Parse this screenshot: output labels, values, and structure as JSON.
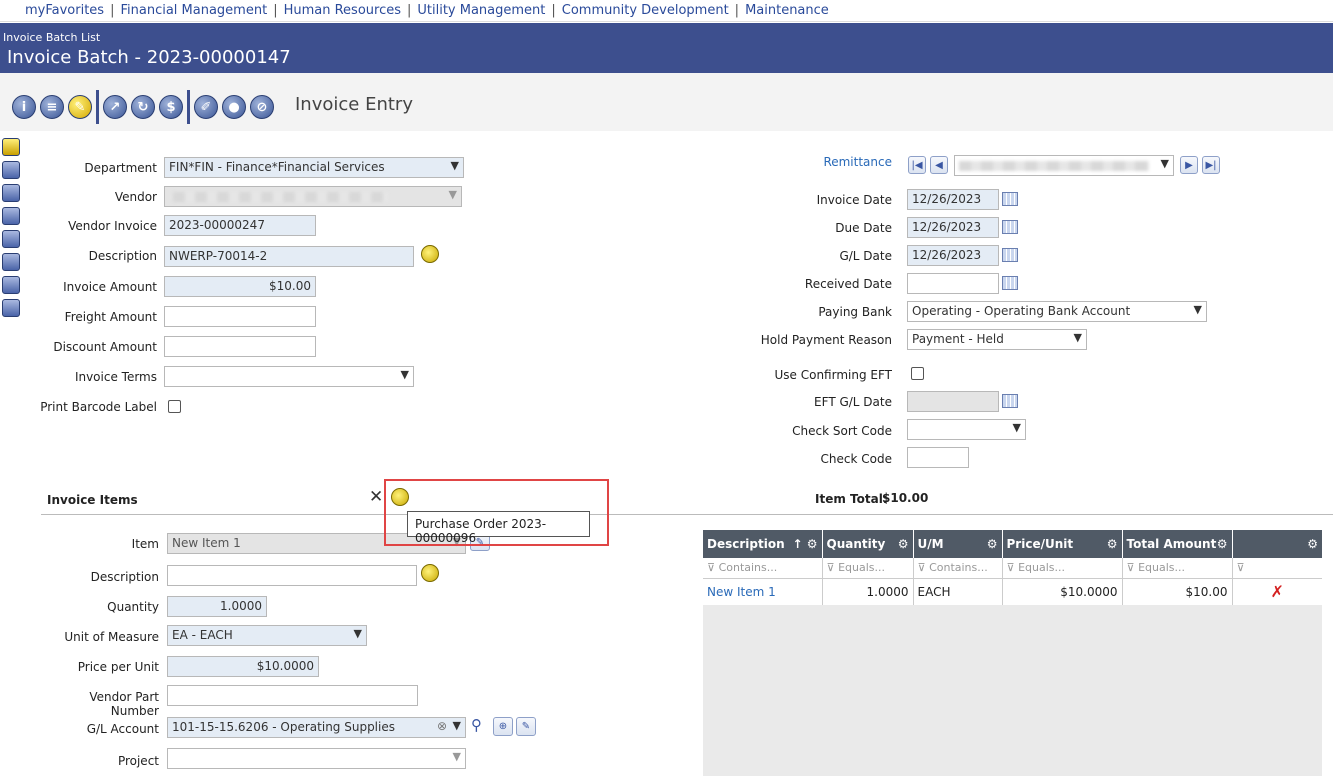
{
  "topnav": {
    "items": [
      "myFavorites",
      "Financial Management",
      "Human Resources",
      "Utility Management",
      "Community Development",
      "Maintenance"
    ]
  },
  "header": {
    "breadcrumb": "Invoice Batch List",
    "title": "Invoice Batch - 2023-00000147"
  },
  "toolbar": {
    "title": "Invoice Entry"
  },
  "form": {
    "department_label": "Department",
    "department_value": "FIN*FIN - Finance*Financial Services",
    "vendor_label": "Vendor",
    "vendor_invoice_label": "Vendor Invoice",
    "vendor_invoice_value": "2023-00000247",
    "description_label": "Description",
    "description_value": "NWERP-70014-2",
    "invoice_amount_label": "Invoice Amount",
    "invoice_amount_value": "$10.00",
    "freight_label": "Freight Amount",
    "discount_label": "Discount Amount",
    "terms_label": "Invoice Terms",
    "barcode_label": "Print Barcode Label"
  },
  "right": {
    "remittance_label": "Remittance",
    "invoice_date_label": "Invoice Date",
    "invoice_date_value": "12/26/2023",
    "due_date_label": "Due Date",
    "due_date_value": "12/26/2023",
    "gl_date_label": "G/L Date",
    "gl_date_value": "12/26/2023",
    "received_label": "Received Date",
    "paying_bank_label": "Paying Bank",
    "paying_bank_value": "Operating - Operating Bank Account",
    "hold_label": "Hold Payment Reason",
    "hold_value": "Payment - Held",
    "eft_label": "Use Confirming EFT",
    "eft_gl_label": "EFT G/L Date",
    "sort_label": "Check Sort Code",
    "check_code_label": "Check Code"
  },
  "items": {
    "section_label": "Invoice Items",
    "tooltip": "Purchase Order 2023-00000096",
    "total_label": "Item Total:",
    "total_value": "$10.00",
    "item_label": "Item",
    "item_value": "New Item 1",
    "desc_label": "Description",
    "qty_label": "Quantity",
    "qty_value": "1.0000",
    "uom_label": "Unit of Measure",
    "uom_value": "EA - EACH",
    "price_label": "Price per Unit",
    "price_value": "$10.0000",
    "vpn_label": "Vendor Part Number",
    "gl_label": "G/L Account",
    "gl_value": "101-15-15.6206 - Operating Supplies",
    "project_label": "Project"
  },
  "grid": {
    "headers": [
      "Description",
      "Quantity",
      "U/M",
      "Price/Unit",
      "Total Amount",
      ""
    ],
    "filters": [
      "Contains...",
      "Equals...",
      "Contains...",
      "Equals...",
      "Equals...",
      ""
    ],
    "row": {
      "description": "New Item 1",
      "quantity": "1.0000",
      "um": "EACH",
      "price": "$10.0000",
      "total": "$10.00"
    }
  }
}
